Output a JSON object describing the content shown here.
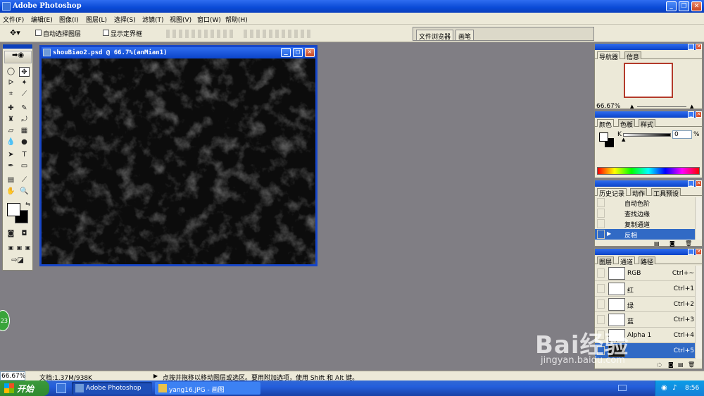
{
  "app": {
    "title": "Adobe Photoshop"
  },
  "menu": [
    "文件(F)",
    "编辑(E)",
    "图像(I)",
    "图层(L)",
    "选择(S)",
    "滤镜(T)",
    "视图(V)",
    "窗口(W)",
    "帮助(H)"
  ],
  "options": {
    "auto_select_label": "自动选择图层",
    "show_bounds_label": "显示定界框",
    "tab_file_browser": "文件浏览器",
    "tab_brushes": "画笔"
  },
  "document": {
    "title": "shouBiao2.psd @ 66.7%(anMian1)"
  },
  "navigator": {
    "tab_navigator": "导航器",
    "tab_info": "信息",
    "zoom": "66.67%"
  },
  "color": {
    "tab_color": "颜色",
    "tab_swatches": "色板",
    "tab_styles": "样式",
    "channel_label": "K",
    "value": "0",
    "unit": "%"
  },
  "history": {
    "tabs": [
      "历史记录",
      "动作",
      "工具预设"
    ],
    "items": [
      {
        "label": "自动色阶",
        "selected": false
      },
      {
        "label": "查找边缘",
        "selected": false
      },
      {
        "label": "复制通道",
        "selected": false
      },
      {
        "label": "反相",
        "selected": true
      }
    ]
  },
  "channels": {
    "tabs": [
      "图层",
      "通道",
      "路径"
    ],
    "rows": [
      {
        "name": "RGB",
        "shortcut": "Ctrl+~",
        "selected": false
      },
      {
        "name": "红",
        "shortcut": "Ctrl+1",
        "selected": false
      },
      {
        "name": "绿",
        "shortcut": "Ctrl+2",
        "selected": false
      },
      {
        "name": "蓝",
        "shortcut": "Ctrl+3",
        "selected": false
      },
      {
        "name": "Alpha 1",
        "shortcut": "Ctrl+4",
        "selected": false
      },
      {
        "name": "",
        "shortcut": "Ctrl+5",
        "selected": true
      }
    ]
  },
  "status": {
    "zoom": "66.67%",
    "doc": "文档:1.37M/938K",
    "hint": "点按并拖移以移动图层或选区。要用附加选项，使用 Shift 和 Alt 键。"
  },
  "taskbar": {
    "start": "开始",
    "items": [
      "Adobe Photoshop",
      "yang16.JPG - 画图"
    ],
    "clock": "8:56"
  },
  "side_badge": "23",
  "watermark": {
    "main": "Bai经验",
    "url": "jingyan.baidu.com"
  },
  "colors": {
    "accent": "#0b44c8",
    "selection": "#316ac5",
    "workspace": "#807e84",
    "chrome": "#ece9d8"
  }
}
